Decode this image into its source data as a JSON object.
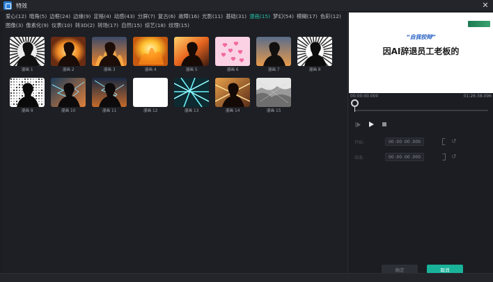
{
  "window": {
    "title": "特效",
    "close_glyph": "✕"
  },
  "categories": [
    {
      "label": "爱心(12)"
    },
    {
      "label": "暗角(5)"
    },
    {
      "label": "边框(24)"
    },
    {
      "label": "边缘(9)"
    },
    {
      "label": "定格(4)"
    },
    {
      "label": "动感(43)"
    },
    {
      "label": "分屏(7)"
    },
    {
      "label": "复古(6)"
    },
    {
      "label": "故障(16)"
    },
    {
      "label": "光影(11)"
    },
    {
      "label": "基础(31)"
    },
    {
      "label": "漫画(15)",
      "active": true
    },
    {
      "label": "梦幻(54)"
    },
    {
      "label": "模糊(17)"
    },
    {
      "label": "色彩(12)"
    },
    {
      "label": "图像(3)"
    },
    {
      "label": "像素化(9)"
    },
    {
      "label": "仪表(10)"
    },
    {
      "label": "转3D(2)"
    },
    {
      "label": "转场(17)"
    },
    {
      "label": "自然(15)"
    },
    {
      "label": "综艺(18)"
    },
    {
      "label": "纹理(15)"
    }
  ],
  "effects": [
    {
      "label": "漫画 1",
      "style": "bw-burst"
    },
    {
      "label": "漫画 2",
      "style": "fire"
    },
    {
      "label": "漫画 3",
      "style": "flames"
    },
    {
      "label": "漫画 4",
      "style": "gold"
    },
    {
      "label": "漫画 5",
      "style": "fire2"
    },
    {
      "label": "漫画 6",
      "style": "hearts"
    },
    {
      "label": "漫画 7",
      "style": "dusk"
    },
    {
      "label": "漫画 8",
      "style": "bw-burst2"
    },
    {
      "label": "漫画 9",
      "style": "halftone"
    },
    {
      "label": "漫画 10",
      "style": "electric"
    },
    {
      "label": "漫画 11",
      "style": "electric2"
    },
    {
      "label": "漫画 12",
      "style": "white"
    },
    {
      "label": "漫画 13",
      "style": "neon"
    },
    {
      "label": "漫画 14",
      "style": "cross"
    },
    {
      "label": "漫画 15",
      "style": "sketch"
    }
  ],
  "preview": {
    "quote": "“自我狡辩”",
    "headline": "因AI辞退员工老板的",
    "logo_text": "",
    "credit": ""
  },
  "timeline": {
    "start": "00:00:00.000",
    "end": "01:26:38.096",
    "progress": 0.0
  },
  "trim": {
    "in_label": "开始:",
    "in_value": "00 :00 :00 .000",
    "out_label": "结束:",
    "out_value": "00 :00 :00 .000"
  },
  "buttons": {
    "ok": "确定",
    "cancel": "取消"
  },
  "colors": {
    "accent": "#19b39a",
    "active_tab": "#22c0a6"
  }
}
